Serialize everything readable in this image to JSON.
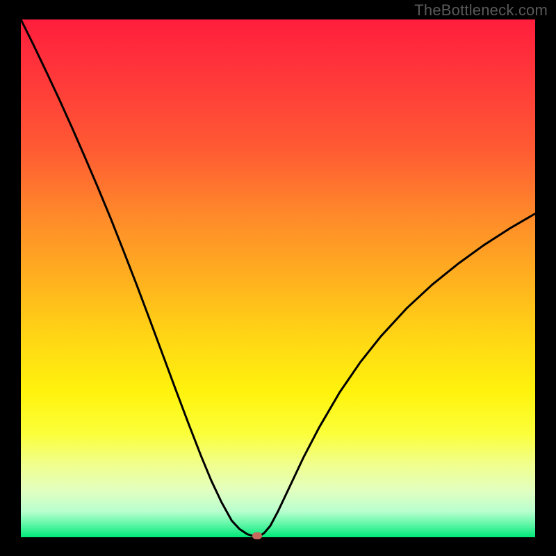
{
  "watermark": "TheBottleneck.com",
  "chart_data": {
    "type": "line",
    "title": "",
    "xlabel": "",
    "ylabel": "",
    "xlim": [
      0,
      100
    ],
    "ylim": [
      0,
      100
    ],
    "background_gradient": {
      "stops": [
        {
          "offset": 0.0,
          "color": "#ff1e3c"
        },
        {
          "offset": 0.12,
          "color": "#ff3a3a"
        },
        {
          "offset": 0.25,
          "color": "#ff5a33"
        },
        {
          "offset": 0.38,
          "color": "#ff8a2a"
        },
        {
          "offset": 0.5,
          "color": "#ffb01f"
        },
        {
          "offset": 0.62,
          "color": "#ffd814"
        },
        {
          "offset": 0.72,
          "color": "#fff30d"
        },
        {
          "offset": 0.8,
          "color": "#fbff3a"
        },
        {
          "offset": 0.86,
          "color": "#f0ff8e"
        },
        {
          "offset": 0.91,
          "color": "#e2ffc0"
        },
        {
          "offset": 0.95,
          "color": "#b9ffcf"
        },
        {
          "offset": 0.975,
          "color": "#60f7a7"
        },
        {
          "offset": 1.0,
          "color": "#00e878"
        }
      ]
    },
    "series": [
      {
        "name": "bottleneck-curve",
        "x": [
          0.0,
          2.5,
          5.0,
          7.5,
          10.0,
          12.5,
          15.0,
          17.5,
          20.0,
          22.5,
          25.0,
          27.5,
          30.0,
          32.5,
          35.0,
          37.0,
          39.0,
          41.0,
          42.5,
          44.0,
          45.0,
          46.0,
          46.7,
          47.3,
          48.5,
          50.0,
          52.0,
          55.0,
          58.0,
          62.0,
          66.0,
          70.0,
          75.0,
          80.0,
          85.0,
          90.0,
          95.0,
          100.0
        ],
        "y": [
          100.0,
          95.0,
          89.8,
          84.5,
          79.0,
          73.3,
          67.5,
          61.5,
          55.2,
          48.8,
          42.2,
          35.5,
          28.8,
          22.2,
          15.8,
          11.0,
          6.8,
          3.2,
          1.6,
          0.6,
          0.3,
          0.3,
          0.4,
          0.8,
          2.2,
          5.0,
          9.2,
          15.5,
          21.2,
          28.0,
          33.8,
          38.8,
          44.2,
          48.8,
          52.8,
          56.4,
          59.6,
          62.5
        ]
      }
    ],
    "marker": {
      "x": 46.0,
      "y": 0.3,
      "color": "#c76a5e"
    }
  }
}
